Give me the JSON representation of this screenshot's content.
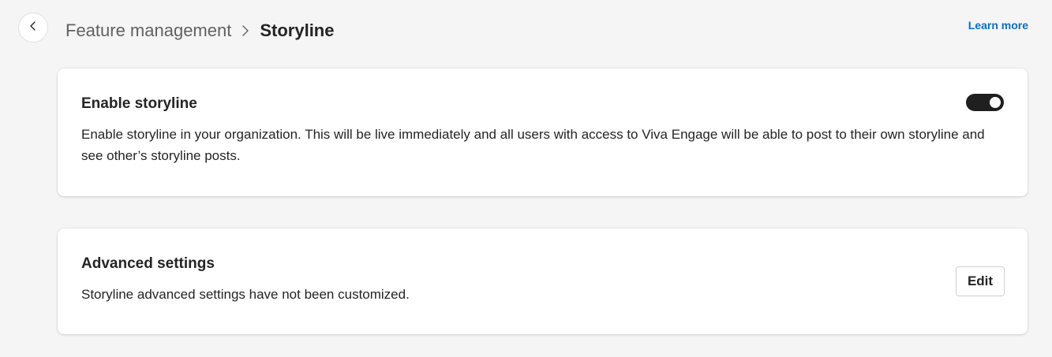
{
  "header": {
    "back_icon": "chevron-left-icon",
    "breadcrumb_parent": "Feature management",
    "breadcrumb_separator_icon": "chevron-right-icon",
    "breadcrumb_current": "Storyline",
    "learn_more": "Learn more"
  },
  "enable_card": {
    "title": "Enable storyline",
    "description": "Enable storyline in your organization. This will be live immediately and all users with access to Viva Engage will be able to post to their own storyline and see other’s storyline posts.",
    "toggle_on": true
  },
  "advanced_card": {
    "title": "Advanced settings",
    "description": "Storyline advanced settings have not been customized.",
    "edit_label": "Edit"
  },
  "colors": {
    "link": "#0f6cbd",
    "toggle_on": "#1f1f1f",
    "background": "#f5f5f5"
  }
}
